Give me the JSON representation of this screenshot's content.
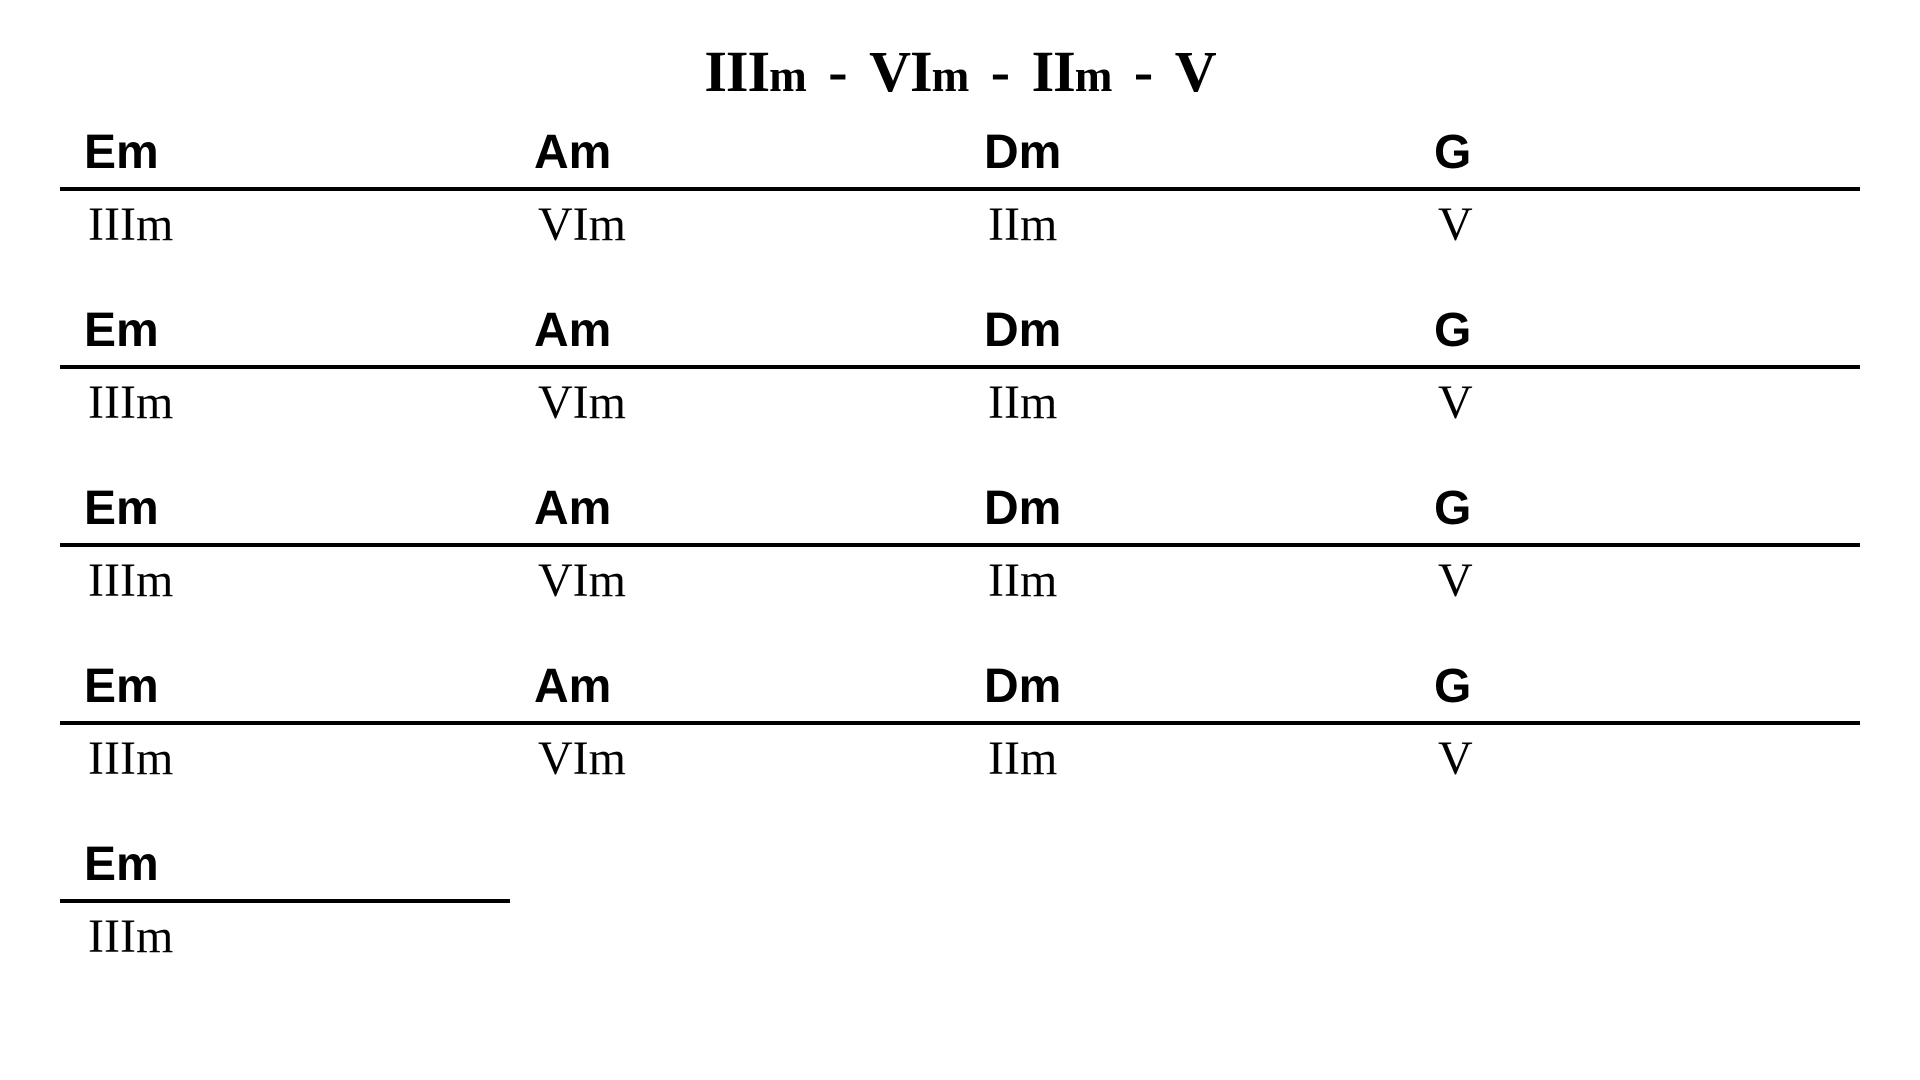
{
  "title_parts": [
    {
      "roman": "III",
      "suffix": "m"
    },
    {
      "roman": "VI",
      "suffix": "m"
    },
    {
      "roman": "II",
      "suffix": "m"
    },
    {
      "roman": "V",
      "suffix": ""
    }
  ],
  "title_separator": "-",
  "rows": [
    [
      {
        "chord": "Em",
        "numeral": "IIIm"
      },
      {
        "chord": "Am",
        "numeral": "VIm"
      },
      {
        "chord": "Dm",
        "numeral": "IIm"
      },
      {
        "chord": "G",
        "numeral": "V"
      }
    ],
    [
      {
        "chord": "Em",
        "numeral": "IIIm"
      },
      {
        "chord": "Am",
        "numeral": "VIm"
      },
      {
        "chord": "Dm",
        "numeral": "IIm"
      },
      {
        "chord": "G",
        "numeral": "V"
      }
    ],
    [
      {
        "chord": "Em",
        "numeral": "IIIm"
      },
      {
        "chord": "Am",
        "numeral": "VIm"
      },
      {
        "chord": "Dm",
        "numeral": "IIm"
      },
      {
        "chord": "G",
        "numeral": "V"
      }
    ],
    [
      {
        "chord": "Em",
        "numeral": "IIIm"
      },
      {
        "chord": "Am",
        "numeral": "VIm"
      },
      {
        "chord": "Dm",
        "numeral": "IIm"
      },
      {
        "chord": "G",
        "numeral": "V"
      }
    ],
    [
      {
        "chord": "Em",
        "numeral": "IIIm"
      }
    ]
  ]
}
